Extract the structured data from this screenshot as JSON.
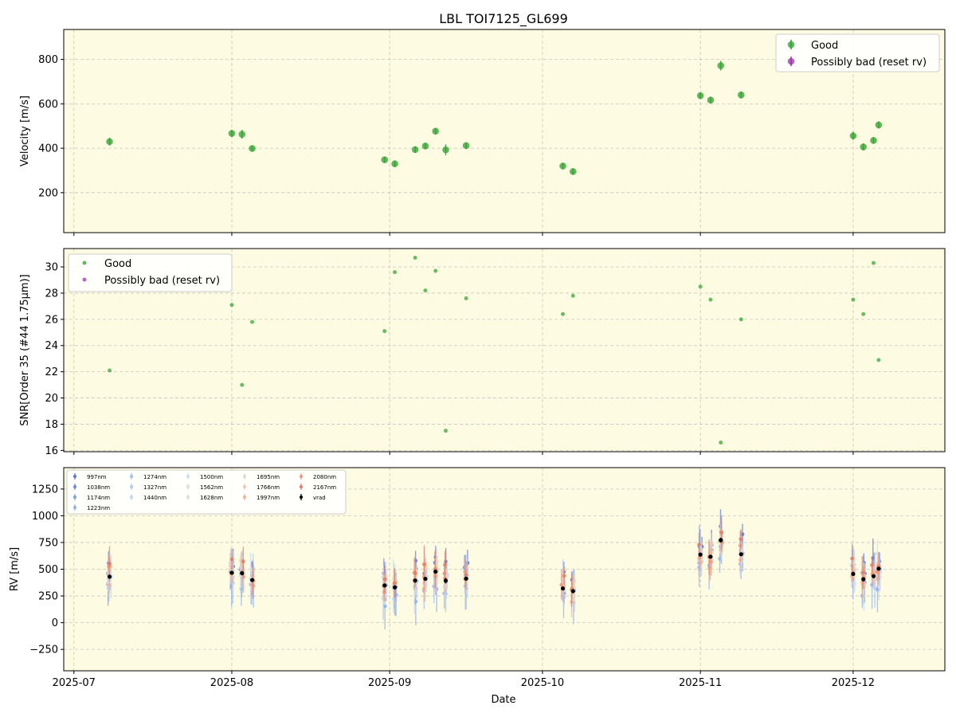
{
  "chart_data": {
    "type": "scatter",
    "title": "LBL TOI7125_GL699",
    "xlabel": "Date",
    "x_ticks": [
      "2025-07",
      "2025-08",
      "2025-09",
      "2025-10",
      "2025-11",
      "2025-12"
    ],
    "dates": [
      "2025-07-08",
      "2025-08-01",
      "2025-08-03",
      "2025-08-05",
      "2025-08-31",
      "2025-09-02",
      "2025-09-06",
      "2025-09-08",
      "2025-09-10",
      "2025-09-12",
      "2025-09-16",
      "2025-10-05",
      "2025-10-07",
      "2025-11-01",
      "2025-11-03",
      "2025-11-05",
      "2025-11-09",
      "2025-12-01",
      "2025-12-03",
      "2025-12-05",
      "2025-12-06"
    ],
    "panels": [
      {
        "ylabel": "Velocity [m/s]",
        "ylim": [
          20,
          935
        ],
        "yticks": [
          200,
          400,
          600,
          800
        ],
        "legend": {
          "placement": "upper right",
          "entries": [
            "Good",
            "Possibly bad (reset rv)"
          ]
        },
        "series": [
          {
            "name": "Good",
            "color": "#2ca02c",
            "y": [
              430,
              467,
              463,
              399,
              348,
              330,
              394,
              410,
              477,
              393,
              412,
              320,
              295,
              637,
              617,
              772,
              640,
              456,
              406,
              435,
              505
            ],
            "err": [
              18,
              16,
              20,
              14,
              13,
              13,
              15,
              14,
              15,
              25,
              15,
              15,
              14,
              14,
              15,
              22,
              16,
              18,
              16,
              15,
              16
            ]
          },
          {
            "name": "Possibly bad (reset rv)",
            "color": "#9932a8",
            "y": [],
            "err": []
          }
        ]
      },
      {
        "ylabel": "SNR[Order 35 (#44 1.75μm)]",
        "ylim": [
          15.9,
          31.4
        ],
        "yticks": [
          16,
          18,
          20,
          22,
          24,
          26,
          28,
          30
        ],
        "legend": {
          "placement": "upper left",
          "entries": [
            "Good",
            "Possibly bad (reset rv)"
          ]
        },
        "series": [
          {
            "name": "Good",
            "color": "#2ca02c",
            "y": [
              22.1,
              27.1,
              21.0,
              25.8,
              25.1,
              29.6,
              30.7,
              28.2,
              29.7,
              17.5,
              27.6,
              26.4,
              27.8,
              28.5,
              27.5,
              16.6,
              26.0,
              27.5,
              26.4,
              30.3,
              22.9
            ]
          },
          {
            "name": "Possibly bad (reset rv)",
            "color": "#9932a8",
            "y": []
          }
        ]
      },
      {
        "ylabel": "RV [m/s]",
        "ylim": [
          -450,
          1450
        ],
        "yticks": [
          -250,
          0,
          250,
          500,
          750,
          1000,
          1250
        ],
        "legend": {
          "placement": "upper left",
          "entries": [
            "997nm",
            "1038nm",
            "1174nm",
            "1223nm",
            "1274nm",
            "1327nm",
            "1440nm",
            "1500nm",
            "1562nm",
            "1628nm",
            "1695nm",
            "1766nm",
            "1997nm",
            "2080nm",
            "2167nm",
            "vrad"
          ]
        },
        "bands": [
          {
            "name": "997nm",
            "color": "#5b74d6",
            "offset": 110,
            "err": 130
          },
          {
            "name": "1038nm",
            "color": "#6b86de",
            "offset": 60,
            "err": 120
          },
          {
            "name": "1174nm",
            "color": "#7c9be8",
            "offset": 0,
            "err": 150
          },
          {
            "name": "1223nm",
            "color": "#8fb0f0",
            "offset": -120,
            "err": 170
          },
          {
            "name": "1274nm",
            "color": "#a1bff4",
            "offset": -60,
            "err": 150
          },
          {
            "name": "1327nm",
            "color": "#b1cbf5",
            "offset": 40,
            "err": 130
          },
          {
            "name": "1440nm",
            "color": "#c3d6f3",
            "offset": -20,
            "err": 200
          },
          {
            "name": "1500nm",
            "color": "#d0dcef",
            "offset": 30,
            "err": 110
          },
          {
            "name": "1562nm",
            "color": "#d9dde6",
            "offset": -40,
            "err": 110
          },
          {
            "name": "1628nm",
            "color": "#dcdcdc",
            "offset": 80,
            "err": 100
          },
          {
            "name": "1695nm",
            "color": "#e6d6cc",
            "offset": 20,
            "err": 100
          },
          {
            "name": "1766nm",
            "color": "#eccab8",
            "offset": 50,
            "err": 100
          },
          {
            "name": "1997nm",
            "color": "#f0b294",
            "offset": -30,
            "err": 120
          },
          {
            "name": "2080nm",
            "color": "#ec9a7c",
            "offset": 15,
            "err": 110
          },
          {
            "name": "2167nm",
            "color": "#e07d66",
            "offset": 70,
            "err": 130
          }
        ],
        "vrad": {
          "name": "vrad",
          "color": "#000000"
        }
      }
    ],
    "grid": true,
    "background": "#fdfce2"
  }
}
